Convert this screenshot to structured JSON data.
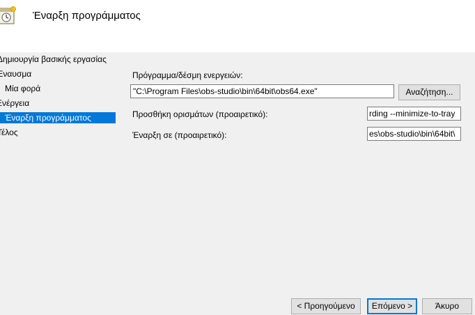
{
  "header": {
    "title": "Έναρξη προγράμματος"
  },
  "nav": {
    "items": [
      {
        "label": "Δημιουργία βασικής εργασίας"
      },
      {
        "label": "Έναυσμα"
      },
      {
        "label": "Μία φορά"
      },
      {
        "label": "Ενέργεια"
      },
      {
        "label": "Έναρξη προγράμματος"
      },
      {
        "label": "Τέλος"
      }
    ],
    "selected_color": "#0078d7"
  },
  "form": {
    "program_label": "Πρόγραμμα/δέσμη ενεργειών:",
    "program_value": "\"C:\\Program Files\\obs-studio\\bin\\64bit\\obs64.exe\"",
    "browse_label": "Αναζήτηση...",
    "args_label": "Προσθήκη ορισμάτων (προαιρετικό):",
    "args_value": "rding --minimize-to-tray",
    "start_label": "Έναρξη σε (προαιρετικό):",
    "start_value": "es\\obs-studio\\bin\\64bit\\"
  },
  "footer": {
    "back_label": "< Προηγούμενο",
    "next_label": "Επόμενο >",
    "cancel_label": "Άκυρο"
  }
}
